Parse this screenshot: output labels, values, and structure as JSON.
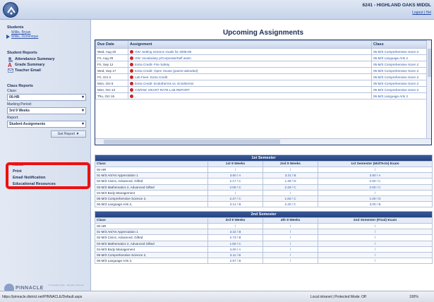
{
  "header": {
    "school": "6241 - HIGHLAND OAKS MIDDL",
    "links": "Logout | Hel"
  },
  "sidebar": {
    "students_heading": "Students",
    "students": [
      "Willis, Bryan",
      "Willis, Dominique"
    ],
    "reports_heading": "Student Reports",
    "report_links": [
      "Attendance Summary",
      "Grade Summary",
      "Teacher Email"
    ],
    "class_reports_heading": "Class Reports",
    "class_label": "Class:",
    "class_value": "00-HR",
    "marking_label": "Marking Period:",
    "marking_value": "3rd 9 Weeks",
    "report_label": "Report:",
    "report_value": "Student Assignments",
    "get_report_btn": "Get Report",
    "bottom_links": [
      "Home",
      "Print",
      "Email Notification",
      "Educational Resources"
    ],
    "brand": "PINNACLE",
    "brand_fine": "© copyright notice · all rights reserved"
  },
  "assignments": {
    "title": "Upcoming Assignments",
    "columns": [
      "Due Date",
      "Assignment",
      "Class"
    ],
    "rows": [
      {
        "due": "Wed, Aug 20",
        "assignment": "HW: Setting Science Goals for 2008-09",
        "class": "05-M/3 Comprehensive Scien 2"
      },
      {
        "due": "Fri, Aug 29",
        "assignment": "HW: Vocabulary p/Corporate/Self assm",
        "class": "06-M/3 Language Arts 2"
      },
      {
        "due": "Fri, Sep 12",
        "assignment": "Extra Credit- Fire Safety",
        "class": "05-M/3 Comprehensive Scien 2"
      },
      {
        "due": "Wed, Sep 17",
        "assignment": "Extra Credit- Open House (parent attended)",
        "class": "05-M/3 Comprehensive Scien 2"
      },
      {
        "due": "Fri, Oct 3",
        "assignment": "Lab Fees- Extra Credit",
        "class": "05-M/3 Comprehensive Scien 2"
      },
      {
        "due": "Mon, Oct 6",
        "assignment": "Extra Credit- Endotherms vs. Ectotherms",
        "class": "05-M/3 Comprehensive Scien 2"
      },
      {
        "due": "Mon, Oct 13",
        "assignment": "CW/HW: HEART RATE LAB REPORT",
        "class": "05-M/3 Comprehensive Scien 2"
      },
      {
        "due": "Thu, Oct 16",
        "assignment": "...",
        "class": "06-M/3 Language Arts 2"
      }
    ]
  },
  "semester1": {
    "title": "1st Semester",
    "columns": [
      "Class",
      "1st 9 Weeks",
      "2nd 9 Weeks",
      "1st Semester (MidTerm) Exam"
    ],
    "rows": [
      {
        "cls": "00-HR",
        "g1": "/",
        "g2": "/",
        "ex": "/"
      },
      {
        "cls": "01-M/3 Art/Art Appreciation 1",
        "g1": "3.60 / A",
        "g2": "3.31 / B",
        "ex": "3.50 / A"
      },
      {
        "cls": "02-M/3 Civics, Advanced, Gifted",
        "g1": "2.17 / C",
        "g2": "1.39 / D",
        "ex": "2.00 / C"
      },
      {
        "cls": "03-M/3 Mathematics 2, Advanced Gifted",
        "g1": "2.00 / C",
        "g2": "2.29 / C",
        "ex": "2.00 / C"
      },
      {
        "cls": "04-M/3 Body Management",
        "g1": "/",
        "g2": "/",
        "ex": "/"
      },
      {
        "cls": "05-M/3 Comprehensive Science 2,",
        "g1": "2.47 / C",
        "g2": "1.60 / C",
        "ex": "1.00 / D"
      },
      {
        "cls": "06-M/3 Language Arts 2,",
        "g1": "3.14 / B",
        "g2": "2.40 / C",
        "ex": "3.00 / B"
      }
    ]
  },
  "semester2": {
    "title": "2nd Semester",
    "columns": [
      "Class",
      "3rd 9 Weeks",
      "4th 9 Weeks",
      "2nd Semester (Final) Exam"
    ],
    "rows": [
      {
        "cls": "00-HR",
        "g1": "/",
        "g2": "/",
        "ex": "/"
      },
      {
        "cls": "01-M/3 Art/Art Appreciation 1",
        "g1": "3.32 / B",
        "g2": "/",
        "ex": "/"
      },
      {
        "cls": "02-M/3 Civics, Advanced, Gifted",
        "g1": "2.73 / B",
        "g2": "/",
        "ex": "/"
      },
      {
        "cls": "03-M/3 Mathematics 2, Advanced Gifted",
        "g1": "1.50 / C",
        "g2": "/",
        "ex": "/"
      },
      {
        "cls": "04-M/3 Body Management",
        "g1": "4.00 / A",
        "g2": "/",
        "ex": "/"
      },
      {
        "cls": "05-M/3 Comprehensive Science 2,",
        "g1": "3.11 / B",
        "g2": "/",
        "ex": "/"
      },
      {
        "cls": "06-M/3 Language Arts 2,",
        "g1": "2.97 / B",
        "g2": "/",
        "ex": "/"
      }
    ]
  },
  "statusbar": {
    "url": "https://pinnacle.district.net/PINNACLE/Default.aspx",
    "zone": "Local intranet | Protected Mode: Off",
    "zoom": "100%"
  },
  "colors": {
    "accent": "#22407c",
    "highlight": "#ef0f0f",
    "alert_dot": "#c7232a"
  }
}
